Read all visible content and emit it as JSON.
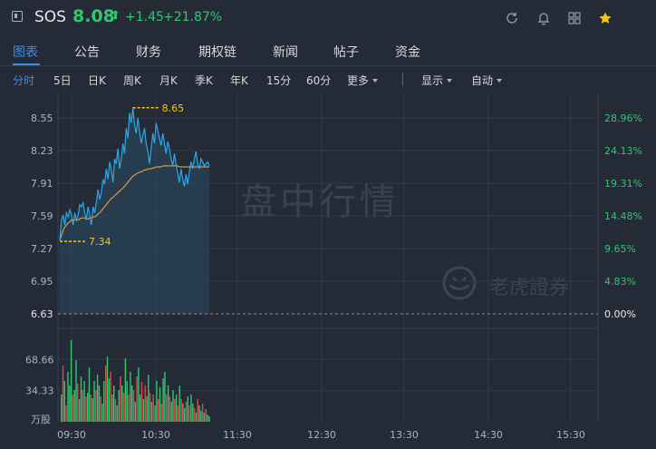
{
  "header": {
    "symbol": "SOS",
    "price": "8.08",
    "arrow_icon": "up-arrow",
    "change": "+1.45",
    "change_pct": "+21.87%",
    "toolbar_icons": [
      "refresh-icon",
      "bell-icon",
      "grid-icon",
      "star-icon"
    ],
    "up_color": "#2fc770",
    "star_color": "#f5c518"
  },
  "tabs": [
    "图表",
    "公告",
    "财务",
    "期权链",
    "新闻",
    "帖子",
    "资金"
  ],
  "active_tab": "图表",
  "periods": [
    "分时",
    "5日",
    "日K",
    "周K",
    "月K",
    "季K",
    "年K",
    "15分",
    "60分",
    "更多"
  ],
  "active_period": "分时",
  "options": {
    "display": "显示",
    "auto": "自动"
  },
  "chart": {
    "left_ticks": [
      "8.55",
      "8.23",
      "7.91",
      "7.59",
      "7.27",
      "6.95",
      "6.63"
    ],
    "right_ticks": [
      "28.96%",
      "24.13%",
      "19.31%",
      "14.48%",
      "9.65%",
      "4.83%",
      "0.00%"
    ],
    "high_label": "8.65",
    "low_label": "7.34",
    "volume_ticks": [
      "68.66",
      "34.33"
    ],
    "volume_unit": "万股",
    "time_labels": [
      "09:30",
      "10:30",
      "11:30",
      "12:30",
      "13:30",
      "14:30",
      "15:30"
    ],
    "watermark_main": "盘中行情",
    "watermark_brand": "老虎證券"
  },
  "chart_data": {
    "type": "line",
    "price_range": [
      6.31,
      8.71
    ],
    "prev_close": 6.63,
    "high": 8.65,
    "low": 7.34,
    "price": [
      7.35,
      7.55,
      7.6,
      7.5,
      7.62,
      7.58,
      7.65,
      7.6,
      7.5,
      7.62,
      7.55,
      7.6,
      7.7,
      7.68,
      7.72,
      7.62,
      7.55,
      7.68,
      7.6,
      7.5,
      7.68,
      7.62,
      7.72,
      7.85,
      7.75,
      7.82,
      7.95,
      7.9,
      8.05,
      7.95,
      8.12,
      8.05,
      7.92,
      8.15,
      8.1,
      8.25,
      8.05,
      8.15,
      8.3,
      8.2,
      8.45,
      8.35,
      8.6,
      8.5,
      8.65,
      8.48,
      8.4,
      8.55,
      8.42,
      8.3,
      8.38,
      8.45,
      8.3,
      8.22,
      8.1,
      8.25,
      8.4,
      8.3,
      8.5,
      8.42,
      8.35,
      8.28,
      8.4,
      8.3,
      8.2,
      8.32,
      8.25,
      8.15,
      8.08,
      8.2,
      8.1,
      8.0,
      7.92,
      8.05,
      7.95,
      7.88,
      8.0,
      7.9,
      8.02,
      8.12,
      8.05,
      8.15,
      8.22,
      8.1,
      8.05,
      8.15,
      8.12,
      8.08,
      8.1,
      8.12,
      8.08
    ],
    "avg": [
      7.35,
      7.4,
      7.45,
      7.48,
      7.5,
      7.52,
      7.53,
      7.55,
      7.55,
      7.55,
      7.55,
      7.55,
      7.56,
      7.57,
      7.57,
      7.57,
      7.56,
      7.56,
      7.57,
      7.57,
      7.58,
      7.58,
      7.59,
      7.61,
      7.62,
      7.64,
      7.66,
      7.68,
      7.7,
      7.72,
      7.74,
      7.76,
      7.77,
      7.79,
      7.8,
      7.82,
      7.83,
      7.85,
      7.86,
      7.88,
      7.9,
      7.92,
      7.94,
      7.96,
      7.98,
      7.99,
      8.0,
      8.01,
      8.02,
      8.02,
      8.03,
      8.04,
      8.04,
      8.05,
      8.05,
      8.05,
      8.06,
      8.06,
      8.07,
      8.07,
      8.07,
      8.07,
      8.08,
      8.08,
      8.08,
      8.08,
      8.08,
      8.08,
      8.08,
      8.08,
      8.08,
      8.08,
      8.07,
      8.07,
      8.07,
      8.07,
      8.07,
      8.07,
      8.07,
      8.07,
      8.07,
      8.07,
      8.07,
      8.07,
      8.07,
      8.07,
      8.07,
      8.07,
      8.07,
      8.07,
      8.07
    ],
    "volume": [
      30,
      62,
      45,
      18,
      55,
      40,
      90,
      30,
      35,
      68,
      42,
      25,
      50,
      35,
      45,
      28,
      32,
      60,
      30,
      26,
      45,
      35,
      52,
      40,
      28,
      20,
      45,
      62,
      72,
      48,
      55,
      30,
      40,
      25,
      18,
      35,
      50,
      40,
      32,
      70,
      45,
      30,
      55,
      40,
      35,
      22,
      50,
      60,
      30,
      44,
      25,
      40,
      28,
      52,
      32,
      22,
      30,
      18,
      45,
      25,
      38,
      20,
      48,
      55,
      30,
      40,
      28,
      22,
      35,
      25,
      30,
      18,
      40,
      25,
      20,
      15,
      22,
      28,
      18,
      30,
      20,
      15,
      10,
      25,
      18,
      12,
      20,
      10,
      14,
      8,
      6
    ],
    "volume_colors": [
      "g",
      "r",
      "g",
      "r",
      "g",
      "g",
      "g",
      "r",
      "g",
      "g",
      "r",
      "g",
      "g",
      "r",
      "g",
      "r",
      "g",
      "g",
      "r",
      "g",
      "g",
      "r",
      "g",
      "g",
      "r",
      "g",
      "g",
      "r",
      "g",
      "g",
      "r",
      "g",
      "g",
      "r",
      "g",
      "g",
      "r",
      "g",
      "r",
      "g",
      "g",
      "r",
      "g",
      "g",
      "r",
      "g",
      "r",
      "g",
      "g",
      "r",
      "g",
      "r",
      "g",
      "g",
      "r",
      "g",
      "r",
      "g",
      "g",
      "r",
      "g",
      "r",
      "g",
      "g",
      "r",
      "g",
      "r",
      "g",
      "g",
      "r",
      "g",
      "r",
      "g",
      "r",
      "g",
      "g",
      "r",
      "g",
      "r",
      "g",
      "g",
      "r",
      "g",
      "r",
      "g",
      "g",
      "r",
      "g",
      "r",
      "g",
      "g"
    ],
    "volume_max": 103
  }
}
